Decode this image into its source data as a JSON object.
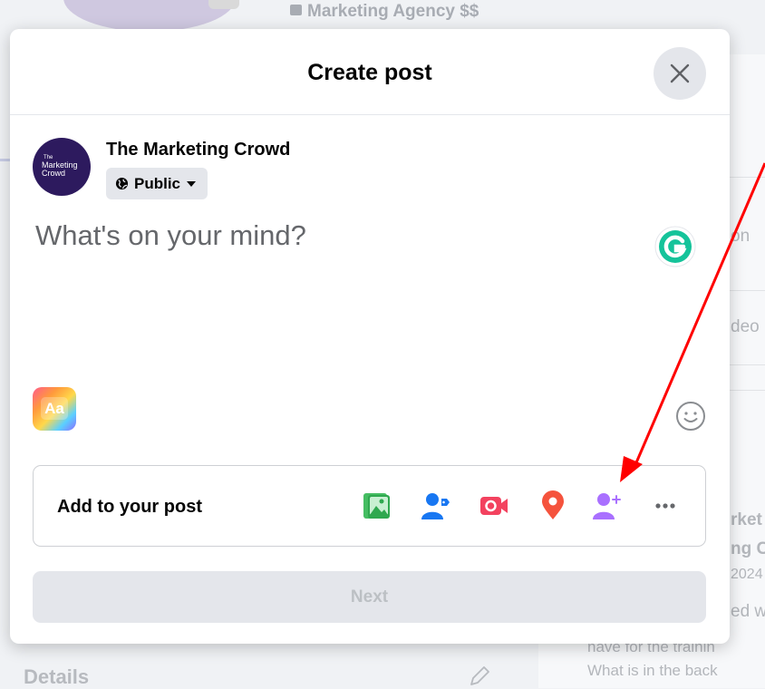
{
  "background": {
    "category_text": "Marketing Agency  $$",
    "right_snippets": [
      "on",
      "deo",
      "rket",
      "ng C",
      "2024",
      "ed w",
      "nave for the trainin",
      "What is in the back"
    ],
    "details_heading": "Details"
  },
  "modal": {
    "title": "Create post",
    "author": {
      "name": "The Marketing Crowd",
      "avatar_lines": [
        "The",
        "Marketing",
        "Crowd"
      ],
      "audience_label": "Public"
    },
    "composer": {
      "placeholder": "What's on your mind?",
      "value": "",
      "text_style_label": "Aa"
    },
    "add_to_post": {
      "label": "Add to your post",
      "options": [
        "photo-video",
        "tag-people",
        "live-video",
        "check-in",
        "invite-people",
        "more"
      ]
    },
    "next_label": "Next"
  },
  "colors": {
    "primary_text": "#050505",
    "secondary_text": "#65676b",
    "button_gray": "#e4e6eb",
    "photo_green": "#45bd62",
    "tag_blue": "#1877f2",
    "live_red": "#f3425f",
    "checkin_orange": "#f5533d",
    "invite_purple": "#a970ff",
    "annotation_red": "#ff0000"
  }
}
